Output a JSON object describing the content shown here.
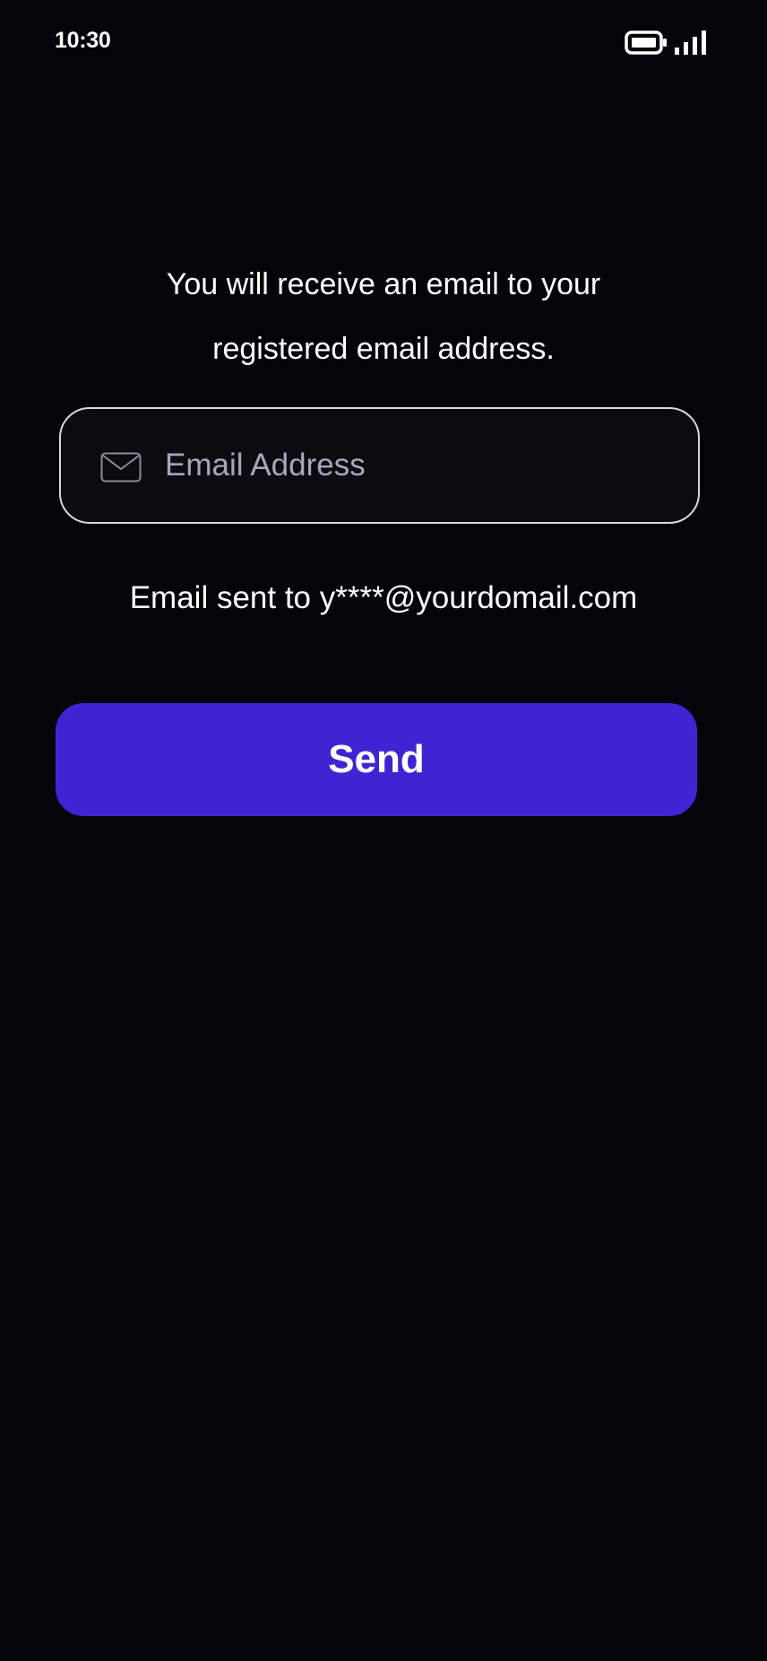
{
  "status_bar": {
    "time": "10:30",
    "battery_icon": "battery-full-icon",
    "signal_icon": "cellular-signal-icon"
  },
  "instruction": {
    "line1": "You will receive an email to your",
    "line2": "registered email address."
  },
  "email_field": {
    "icon": "mail-icon",
    "placeholder": "Email Address",
    "value": ""
  },
  "sent_notice": "Email sent to y****@yourdomail.com",
  "send_button": {
    "label": "Send"
  },
  "colors": {
    "background": "#05040a",
    "accent": "#4024d4",
    "field_border": "#d9d6e6",
    "placeholder": "#a9a5bd"
  }
}
